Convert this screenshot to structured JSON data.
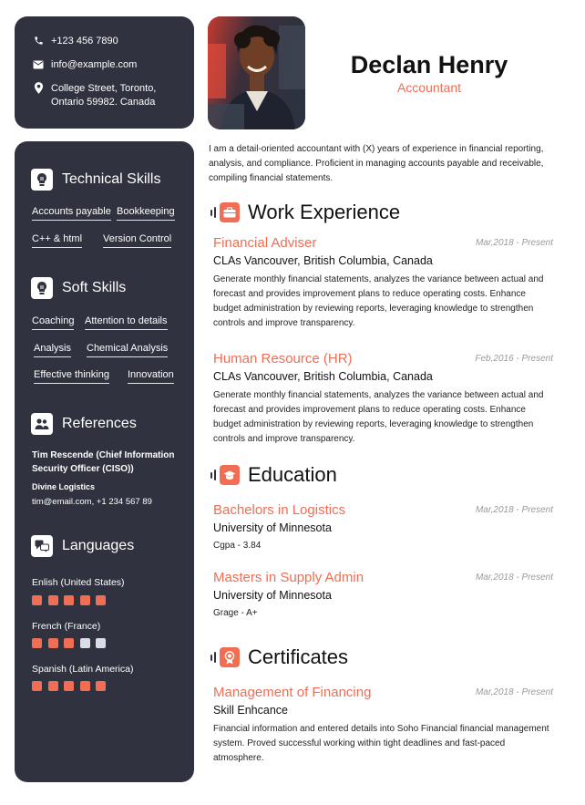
{
  "contact": {
    "phone": "+123 456 7890",
    "email": "info@example.com",
    "address_line1": "College Street, Toronto,",
    "address_line2": "Ontario 59982. Canada"
  },
  "header": {
    "name": "Declan Henry",
    "role": "Accountant"
  },
  "summary": "I am a detail-oriented accountant with (X) years of experience in financial reporting, analysis, and compliance. Proficient in managing accounts payable and receivable, compiling financial statements.",
  "technical_skills": {
    "title": "Technical Skills",
    "items": [
      "Accounts payable",
      "Bookkeeping",
      "C++ & html",
      "Version Control"
    ]
  },
  "soft_skills": {
    "title": "Soft Skills",
    "items": [
      "Coaching",
      "Attention to details",
      "Analysis",
      "Chemical Analysis",
      "Effective thinking",
      "Innovation"
    ]
  },
  "references": {
    "title": "References",
    "name": "Tim Rescende (Chief Information Security Officer (CISO))",
    "company": "Divine Logistics",
    "contact": "tim@email.com, +1 234 567 89"
  },
  "languages": {
    "title": "Languages",
    "items": [
      {
        "name": "Enlish (United States)",
        "level": 5,
        "max": 5
      },
      {
        "name": "French (France)",
        "level": 3,
        "max": 5
      },
      {
        "name": "Spanish (Latin America)",
        "level": 5,
        "max": 5
      }
    ]
  },
  "work": {
    "title": "Work Experience",
    "items": [
      {
        "title": "Financial Adviser",
        "date": "Mar,2018 - Present",
        "company": "CLAs Vancouver, British Columbia, Canada",
        "desc": "Generate monthly financial statements, analyzes the variance between actual and forecast and provides improvement plans to reduce operating costs. Enhance budget administration by reviewing reports, leveraging knowledge to strengthen controls and improve transparency."
      },
      {
        "title": "Human Resource (HR)",
        "date": "Feb,2016 - Present",
        "company": "CLAs Vancouver, British Columbia, Canada",
        "desc": "Generate monthly financial statements, analyzes the variance between actual and forecast and provides improvement plans to reduce operating costs. Enhance budget administration by reviewing reports, leveraging knowledge to strengthen controls and improve transparency."
      }
    ]
  },
  "education": {
    "title": "Education",
    "items": [
      {
        "title": "Bachelors in Logistics",
        "date": "Mar,2018 - Present",
        "school": "University of Minnesota",
        "grade": "Cgpa - 3.84"
      },
      {
        "title": "Masters in Supply Admin",
        "date": "Mar,2018 - Present",
        "school": "University of Minnesota",
        "grade": "Grage - A+"
      }
    ]
  },
  "certificates": {
    "title": "Certificates",
    "items": [
      {
        "title": "Management of Financing",
        "date": "Mar,2018 - Present",
        "subtitle": "Skill Enhcance",
        "desc": "Financial information and entered details into Soho Financial financial management system. Proved successful working within tight deadlines and fast-paced atmosphere."
      }
    ]
  },
  "colors": {
    "accent": "#ef6e54",
    "panel": "#30323f",
    "level_off": "#d9dde6"
  },
  "icons": {
    "phone": "phone-icon",
    "email": "envelope-icon",
    "address": "map-pin-icon",
    "technical": "lightbulb-icon",
    "soft": "lightbulb-icon",
    "references": "people-icon",
    "languages": "speech-bubbles-icon",
    "work": "briefcase-icon",
    "education": "graduation-cap-icon",
    "certificates": "award-ribbon-icon"
  }
}
